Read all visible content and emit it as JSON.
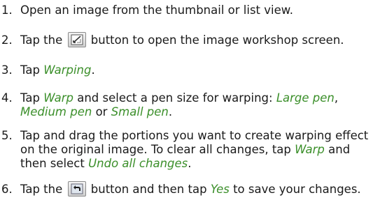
{
  "steps": [
    {
      "number": "1.",
      "parts": [
        "Open an image from the thumbnail or list view."
      ]
    },
    {
      "number": "2.",
      "before": "Tap the",
      "icon": "image-workshop-icon",
      "after": "button to open the image workshop screen."
    },
    {
      "number": "3.",
      "before": "Tap",
      "em1": "Warping",
      "after": "."
    },
    {
      "number": "4.",
      "before": "Tap",
      "em1": "Warp",
      "mid1": "and select a pen size for warping:",
      "em2": "Large pen",
      "mid2": ",",
      "em3": "Medium pen",
      "mid3": "or",
      "em4": "Small pen",
      "after": "."
    },
    {
      "number": "5.",
      "line1": "Tap and drag the portions you want to create warping effect",
      "line2": "on the original image. To clear all changes, tap",
      "em1": "Warp",
      "mid1": "and",
      "line3_before": "then select",
      "em2": "Undo all changes",
      "after": "."
    },
    {
      "number": "6.",
      "before": "Tap the",
      "icon": "back-arrow-icon",
      "mid1": "button and then tap",
      "em1": "Yes",
      "after": "to save your changes."
    }
  ],
  "colors": {
    "emphasis": "#3b8f2a",
    "text": "#1a1a1a"
  }
}
